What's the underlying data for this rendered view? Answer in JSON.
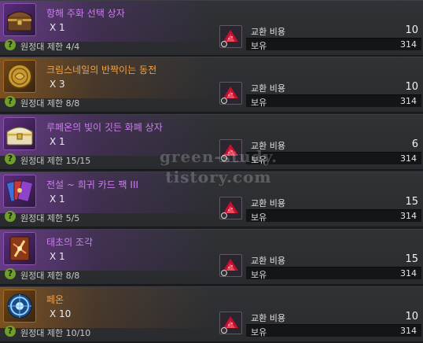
{
  "rows": [
    {
      "name": "항해 주화 선택 상자",
      "qty": "X 1",
      "limit": "원정대 제한 4/4",
      "cost_label": "교환 비용",
      "cost": "10",
      "hold_label": "보유",
      "hold": "314",
      "grade": "purple",
      "icon": "voyage-coin-chest-icon"
    },
    {
      "name": "크림스네일의 반짝이는 동전",
      "qty": "X 3",
      "limit": "원정대 제한 8/8",
      "cost_label": "교환 비용",
      "cost": "10",
      "hold_label": "보유",
      "hold": "314",
      "grade": "orange",
      "icon": "gold-coin-icon"
    },
    {
      "name": "루페온의 빛이 깃든 화폐 상자",
      "qty": "X 1",
      "limit": "원정대 제한 15/15",
      "cost_label": "교환 비용",
      "cost": "6",
      "hold_label": "보유",
      "hold": "314",
      "grade": "purple",
      "icon": "treasure-chest-icon"
    },
    {
      "name": "전설 ~ 희귀 카드 팩 III",
      "qty": "X 1",
      "limit": "원정대 제한 5/5",
      "cost_label": "교환 비용",
      "cost": "15",
      "hold_label": "보유",
      "hold": "314",
      "grade": "purple",
      "icon": "card-pack-icon"
    },
    {
      "name": "태초의 조각",
      "qty": "X 1",
      "limit": "원정대 제한 8/8",
      "cost_label": "교환 비용",
      "cost": "15",
      "hold_label": "보유",
      "hold": "314",
      "grade": "purple",
      "icon": "primal-shard-icon"
    },
    {
      "name": "페온",
      "qty": "X 10",
      "limit": "원정대 제한 10/10",
      "cost_label": "교환 비용",
      "cost": "10",
      "hold_label": "보유",
      "hold": "314",
      "grade": "orange",
      "icon": "pheon-icon"
    }
  ],
  "watermark": {
    "line1": "green-study.",
    "line2": "tistory.com"
  },
  "currency": {
    "icon": "red-crystal-currency-icon",
    "color": "#c8102e"
  },
  "colors": {
    "purple_grade": "#cf7cf3",
    "orange_grade": "#f0a14a",
    "background": "#1c1d20"
  }
}
